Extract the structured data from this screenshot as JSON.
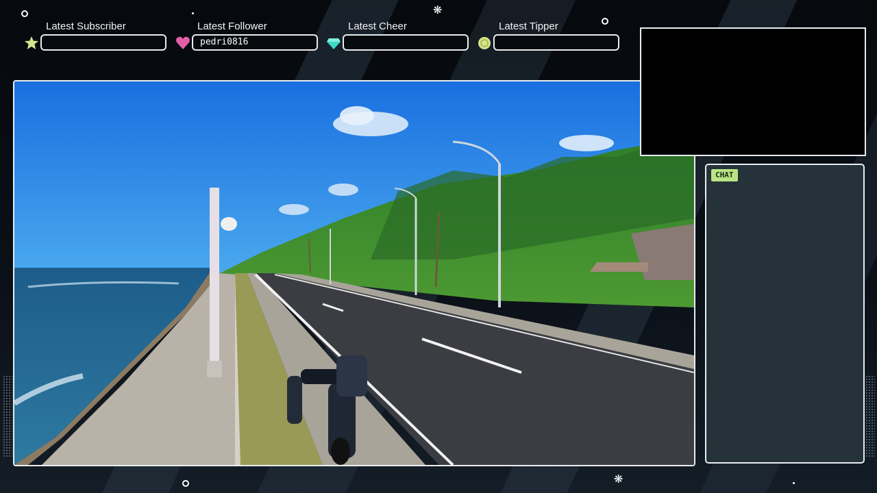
{
  "alerts": [
    {
      "title": "Latest Subscriber",
      "value": "",
      "icon": "star-icon",
      "color": "#d6e58a"
    },
    {
      "title": "Latest Follower",
      "value": "pedri0816",
      "icon": "heart-icon",
      "color": "#e060a8"
    },
    {
      "title": "Latest Cheer",
      "value": "",
      "icon": "gem-icon",
      "color": "#3ed6c4"
    },
    {
      "title": "Latest Tipper",
      "value": "",
      "icon": "coin-icon",
      "color": "#d6e58a"
    }
  ],
  "chat": {
    "tab_label": "CHAT"
  },
  "colors": {
    "frame_border": "#e9edf0",
    "chat_bg": "#25323a",
    "chat_tab_bg": "#b9e486",
    "background": "#05070a"
  }
}
